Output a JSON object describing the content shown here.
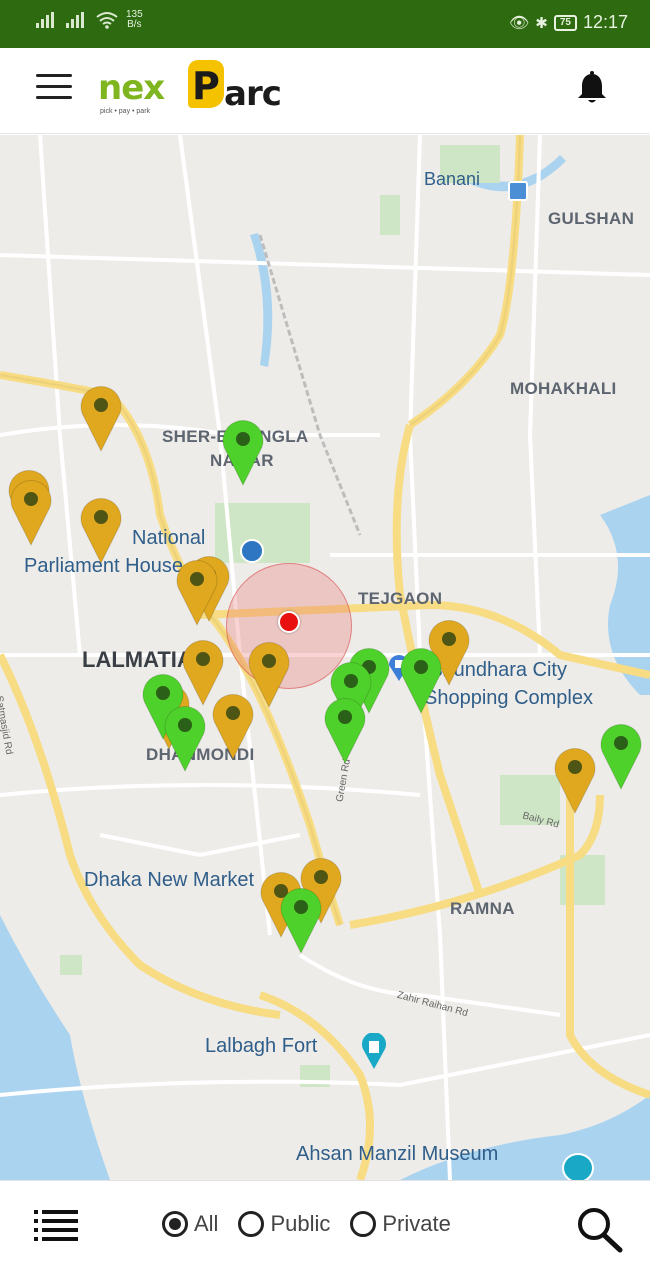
{
  "status_bar": {
    "net_speed_value": "135",
    "net_speed_unit": "B/s",
    "battery": "75",
    "time": "12:17"
  },
  "app_bar": {
    "logo_part1": "nex",
    "logo_part2": "P",
    "logo_part3": "arc",
    "logo_tagline": "pick • pay • park",
    "menu_icon": "hamburger-icon",
    "notification_icon": "bell-icon"
  },
  "map": {
    "labels": {
      "banani": "Banani",
      "gulshan": "GULSHAN",
      "mohakhali": "MOHAKHALI",
      "sher_e_bangla": "SHER-E-BANGLA",
      "nagar": "NAGAR",
      "national": "National",
      "parliament": "Parliament House",
      "tejgaon": "TEJGAON",
      "lalmatia": "LALMATIA",
      "bashundhara1": "Bashundhara City",
      "bashundhara2": "Shopping Complex",
      "dhanmondi": "DHANMONDI",
      "green_rd": "Green Rd",
      "bailey_rd": "Baily Rd",
      "new_market": "Dhaka New Market",
      "ramna": "RAMNA",
      "zahir_raihan": "Zahir Raihan Rd",
      "lalbagh": "Lalbagh Fort",
      "ahsan": "Ahsan Manzil Museum",
      "satmasjid": "Satmasjid Rd"
    },
    "pin_colors": {
      "public": "#e0a81f",
      "private": "#4fd12c"
    }
  },
  "bottom_bar": {
    "list_icon": "list-icon",
    "filter_all": "All",
    "filter_public": "Public",
    "filter_private": "Private",
    "selected_filter": "All",
    "search_icon": "search-icon"
  }
}
